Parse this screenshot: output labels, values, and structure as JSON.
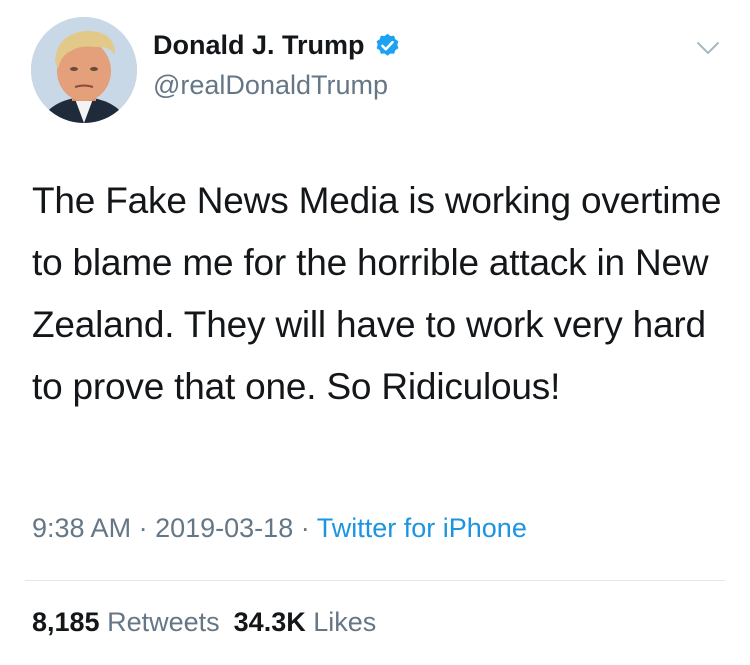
{
  "author": {
    "display_name": "Donald J. Trump",
    "handle": "@realDonaldTrump",
    "verified": true,
    "avatar_icon": "profile-photo"
  },
  "menu_icon": "chevron-down-icon",
  "tweet": {
    "text": "The Fake News Media is working overtime to blame me for the horrible attack in New Zealand. They will have to work very hard to prove that one. So Ridiculous!"
  },
  "meta": {
    "time": "9:38 AM",
    "separator": "·",
    "date": "2019-03-18",
    "source": "Twitter for iPhone"
  },
  "stats": {
    "retweets_count": "8,185",
    "retweets_label": "Retweets",
    "likes_count": "34.3K",
    "likes_label": "Likes"
  },
  "colors": {
    "text": "#14171a",
    "secondary": "#657786",
    "accent": "#1b95e0",
    "divider": "#e1e8ed"
  }
}
